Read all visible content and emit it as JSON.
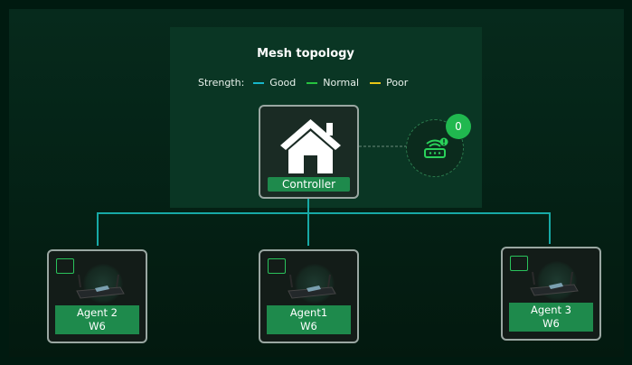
{
  "title": "Mesh topology",
  "legend": {
    "label": "Strength:",
    "items": [
      {
        "name": "Good",
        "color": "#17b6c9"
      },
      {
        "name": "Normal",
        "color": "#26c23f"
      },
      {
        "name": "Poor",
        "color": "#e7c516"
      }
    ]
  },
  "controller": {
    "label": "Controller",
    "icon": "home-icon"
  },
  "satellite": {
    "badge_count": "0",
    "icon": "router-warning-icon"
  },
  "agents": [
    {
      "name": "Agent 2",
      "model": "W6",
      "icon": "ethernet-port-icon"
    },
    {
      "name": "Agent1",
      "model": "W6",
      "icon": "ethernet-port-icon"
    },
    {
      "name": "Agent 3",
      "model": "W6",
      "icon": "ethernet-port-icon"
    }
  ],
  "colors": {
    "accent_green": "#1e8a4c",
    "link_teal": "#17a9a6",
    "background": "#001a10"
  }
}
